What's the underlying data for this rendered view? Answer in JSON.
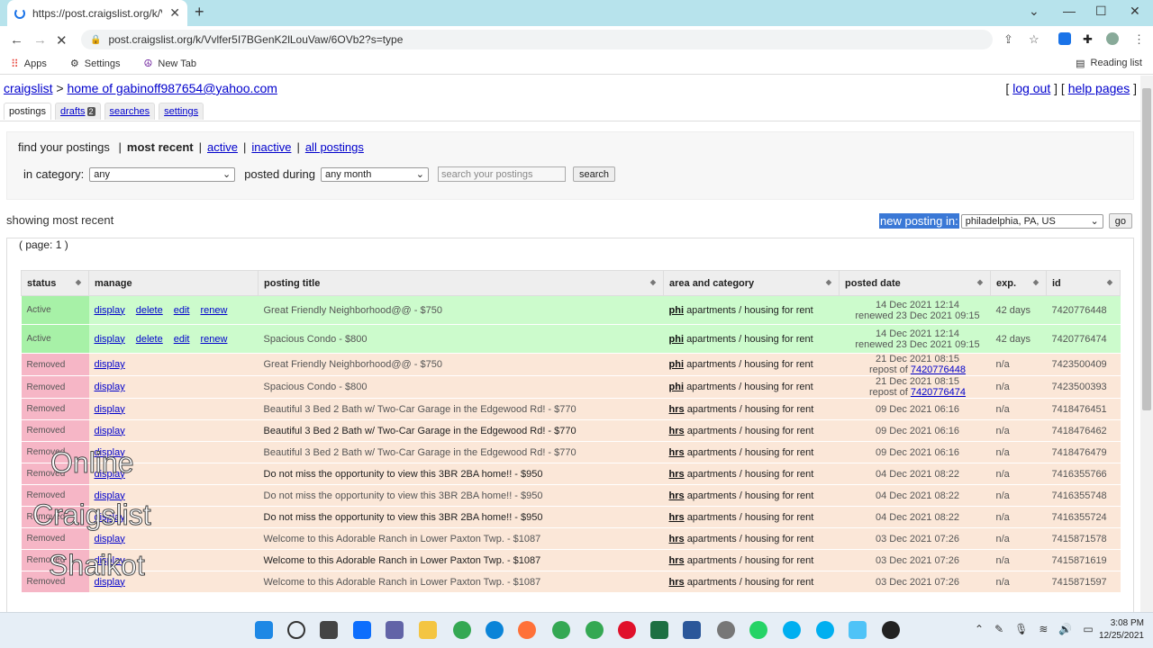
{
  "browser": {
    "tab_title": "https://post.craigslist.org/k/Vvlfe",
    "new_tab": "+",
    "url": "post.craigslist.org/k/Vvlfer5I7BGenK2lLouVaw/6OVb2?s=type",
    "bookmarks": [
      {
        "label": "Apps",
        "icon": "apps-grid-icon"
      },
      {
        "label": "Settings",
        "icon": "gear-icon"
      },
      {
        "label": "New Tab",
        "icon": "peace-icon"
      }
    ],
    "reading_list": "Reading list"
  },
  "header": {
    "site": "craigslist",
    "separator": ">",
    "home": "home of gabinoff987654@yahoo.com",
    "log_out": "log out",
    "help_pages": "help pages"
  },
  "tabs": [
    {
      "label": "postings"
    },
    {
      "label": "drafts",
      "badge": "2"
    },
    {
      "label": "searches"
    },
    {
      "label": "settings"
    }
  ],
  "filters": {
    "find_label": "find your postings",
    "most_recent": "most recent",
    "active": "active",
    "inactive": "inactive",
    "all_postings": "all postings",
    "in_category": "in category:",
    "category_value": "any",
    "posted_during": "posted during",
    "period_value": "any month",
    "search_placeholder": "search your postings",
    "search_button": "search"
  },
  "showing": "showing most recent",
  "new_posting": {
    "label": "new posting in:",
    "location": "philadelphia, PA, US",
    "go": "go"
  },
  "page_label": "( page: 1 )",
  "table": {
    "headers": [
      "status",
      "manage",
      "posting title",
      "area and category",
      "posted date",
      "exp.",
      "id"
    ],
    "rows": [
      {
        "status": "Active",
        "type": "active",
        "manage": [
          "display",
          "delete",
          "edit",
          "renew"
        ],
        "title": "Great Friendly Neighborhood@@ - $750",
        "area": "phi",
        "cat": "apartments / housing for rent",
        "date1": "14 Dec 2021 12:14",
        "date2": "renewed 23 Dec 2021 09:15",
        "exp": "42 days",
        "id": "7420776448"
      },
      {
        "status": "Active",
        "type": "active",
        "manage": [
          "display",
          "delete",
          "edit",
          "renew"
        ],
        "title": "Spacious Condo - $800",
        "area": "phi",
        "cat": "apartments / housing for rent",
        "date1": "14 Dec 2021 12:14",
        "date2": "renewed 23 Dec 2021 09:15",
        "exp": "42 days",
        "id": "7420776474"
      },
      {
        "status": "Removed",
        "type": "removed",
        "manage": [
          "display"
        ],
        "title": "Great Friendly Neighborhood@@ - $750",
        "area": "phi",
        "cat": "apartments / housing for rent",
        "date1": "21 Dec 2021 08:15",
        "date2": "repost of ",
        "repost": "7420776448",
        "exp": "n/a",
        "id": "7423500409"
      },
      {
        "status": "Removed",
        "type": "removed",
        "manage": [
          "display"
        ],
        "title": "Spacious Condo - $800",
        "area": "phi",
        "cat": "apartments / housing for rent",
        "date1": "21 Dec 2021 08:15",
        "date2": "repost of ",
        "repost": "7420776474",
        "exp": "n/a",
        "id": "7423500393"
      },
      {
        "status": "Removed",
        "type": "removed",
        "manage": [
          "display"
        ],
        "title": "Beautiful 3 Bed 2 Bath w/ Two-Car Garage in the Edgewood Rd! - $770",
        "area": "hrs",
        "cat": "apartments / housing for rent",
        "date1": "09 Dec 2021 06:16",
        "exp": "n/a",
        "id": "7418476451"
      },
      {
        "status": "Removed",
        "type": "removed",
        "manage": [
          "display"
        ],
        "title": "Beautiful 3 Bed 2 Bath w/ Two-Car Garage in the Edgewood Rd! - $770",
        "area": "hrs",
        "cat": "apartments / housing for rent",
        "date1": "09 Dec 2021 06:16",
        "exp": "n/a",
        "id": "7418476462"
      },
      {
        "status": "Removed",
        "type": "removed",
        "manage": [
          "display"
        ],
        "title": "Beautiful 3 Bed 2 Bath w/ Two-Car Garage in the Edgewood Rd! - $770",
        "area": "hrs",
        "cat": "apartments / housing for rent",
        "date1": "09 Dec 2021 06:16",
        "exp": "n/a",
        "id": "7418476479"
      },
      {
        "status": "Removed",
        "type": "removed",
        "manage": [
          "display"
        ],
        "title": "Do not miss the opportunity to view this 3BR 2BA home!! - $950",
        "area": "hrs",
        "cat": "apartments / housing for rent",
        "date1": "04 Dec 2021 08:22",
        "exp": "n/a",
        "id": "7416355766"
      },
      {
        "status": "Removed",
        "type": "removed",
        "manage": [
          "display"
        ],
        "title": "Do not miss the opportunity to view this 3BR 2BA home!! - $950",
        "area": "hrs",
        "cat": "apartments / housing for rent",
        "date1": "04 Dec 2021 08:22",
        "exp": "n/a",
        "id": "7416355748"
      },
      {
        "status": "Removed",
        "type": "removed",
        "manage": [
          "display"
        ],
        "title": "Do not miss the opportunity to view this 3BR 2BA home!! - $950",
        "area": "hrs",
        "cat": "apartments / housing for rent",
        "date1": "04 Dec 2021 08:22",
        "exp": "n/a",
        "id": "7416355724"
      },
      {
        "status": "Removed",
        "type": "removed",
        "manage": [
          "display"
        ],
        "title": "Welcome to this Adorable Ranch in Lower Paxton Twp. - $1087",
        "area": "hrs",
        "cat": "apartments / housing for rent",
        "date1": "03 Dec 2021 07:26",
        "exp": "n/a",
        "id": "7415871578"
      },
      {
        "status": "Removed",
        "type": "removed",
        "manage": [
          "display"
        ],
        "title": "Welcome to this Adorable Ranch in Lower Paxton Twp. - $1087",
        "area": "hrs",
        "cat": "apartments / housing for rent",
        "date1": "03 Dec 2021 07:26",
        "exp": "n/a",
        "id": "7415871619"
      },
      {
        "status": "Removed",
        "type": "removed",
        "manage": [
          "display"
        ],
        "title": "Welcome to this Adorable Ranch in Lower Paxton Twp. - $1087",
        "area": "hrs",
        "cat": "apartments / housing for rent",
        "date1": "03 Dec 2021 07:26",
        "exp": "n/a",
        "id": "7415871597"
      }
    ]
  },
  "watermark": [
    "Online",
    "Craigslist",
    "Shaikot"
  ],
  "taskbar": {
    "time": "3:08 PM",
    "date": "12/25/2021"
  }
}
